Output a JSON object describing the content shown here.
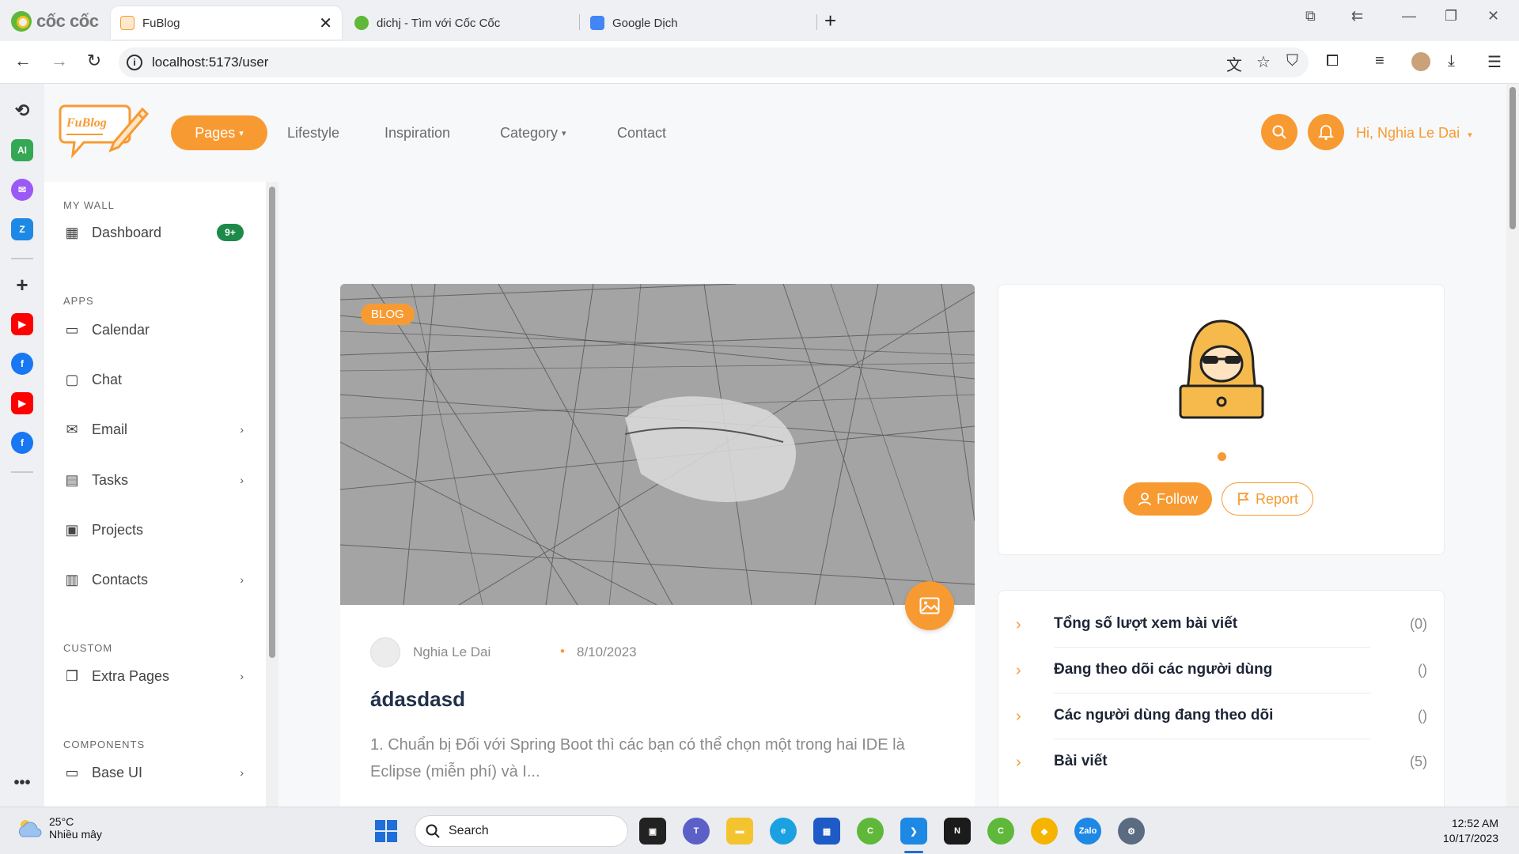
{
  "browser": {
    "brand": "cốc cốc",
    "tabs": [
      {
        "title": "FuBlog"
      },
      {
        "title": "dichj - Tìm với Cốc Cốc"
      },
      {
        "title": "Google Dịch"
      }
    ],
    "url": "localhost:5173/user"
  },
  "site": {
    "logo_text": "FuBlog",
    "nav": {
      "pages": "Pages",
      "lifestyle": "Lifestyle",
      "inspiration": "Inspiration",
      "category": "Category",
      "contact": "Contact"
    },
    "greeting": "Hi, Nghia Le Dai"
  },
  "sidebar": {
    "my_wall": "MY WALL",
    "dashboard": "Dashboard",
    "dashboard_badge": "9+",
    "apps": "APPS",
    "calendar": "Calendar",
    "chat": "Chat",
    "email": "Email",
    "tasks": "Tasks",
    "projects": "Projects",
    "contacts": "Contacts",
    "custom": "CUSTOM",
    "extra_pages": "Extra Pages",
    "components": "COMPONENTS",
    "base_ui": "Base UI"
  },
  "post": {
    "tag": "BLOG",
    "author": "Nghia Le Dai",
    "date": "8/10/2023",
    "title": "ádasdasd",
    "excerpt": "1. Chuẩn bị Đối với Spring Boot thì các bạn có thể chọn một trong hai IDE là Eclipse (miễn phí) và I..."
  },
  "profile": {
    "follow": "Follow",
    "report": "Report"
  },
  "stats": [
    {
      "label": "Tổng số lượt xem bài viết",
      "count": "(0)"
    },
    {
      "label": "Đang theo dõi các người dùng",
      "count": "()"
    },
    {
      "label": "Các người dùng đang theo dõi",
      "count": "()"
    },
    {
      "label": "Bài viết",
      "count": "(5)"
    }
  ],
  "taskbar": {
    "temperature": "25°C",
    "weather": "Nhiều mây",
    "search": "Search",
    "time": "12:52 AM",
    "date": "10/17/2023"
  },
  "colors": {
    "accent": "#f89a32",
    "badge": "#1d8a4a",
    "title": "#223049"
  }
}
